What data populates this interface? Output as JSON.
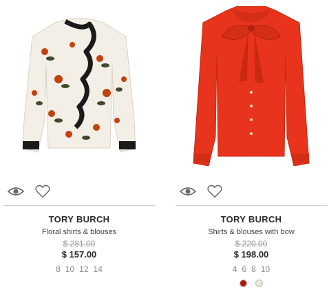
{
  "products": [
    {
      "brand": "TORY BURCH",
      "category": "Floral shirts & blouses",
      "old_price": "$ 281.00",
      "new_price": "$ 157.00",
      "sizes": [
        "8",
        "10",
        "12",
        "14"
      ],
      "image_icon": "floral-blouse-image",
      "colors": []
    },
    {
      "brand": "TORY BURCH",
      "category": "Shirts & blouses with bow",
      "old_price": "$ 220.00",
      "new_price": "$ 198.00",
      "sizes": [
        "4",
        "6",
        "8",
        "10"
      ],
      "image_icon": "red-bow-blouse-image",
      "colors": [
        "#b3140f",
        "#ece6d2"
      ]
    }
  ],
  "icons": {
    "quick_view": "eye-icon",
    "wishlist": "heart-icon"
  }
}
